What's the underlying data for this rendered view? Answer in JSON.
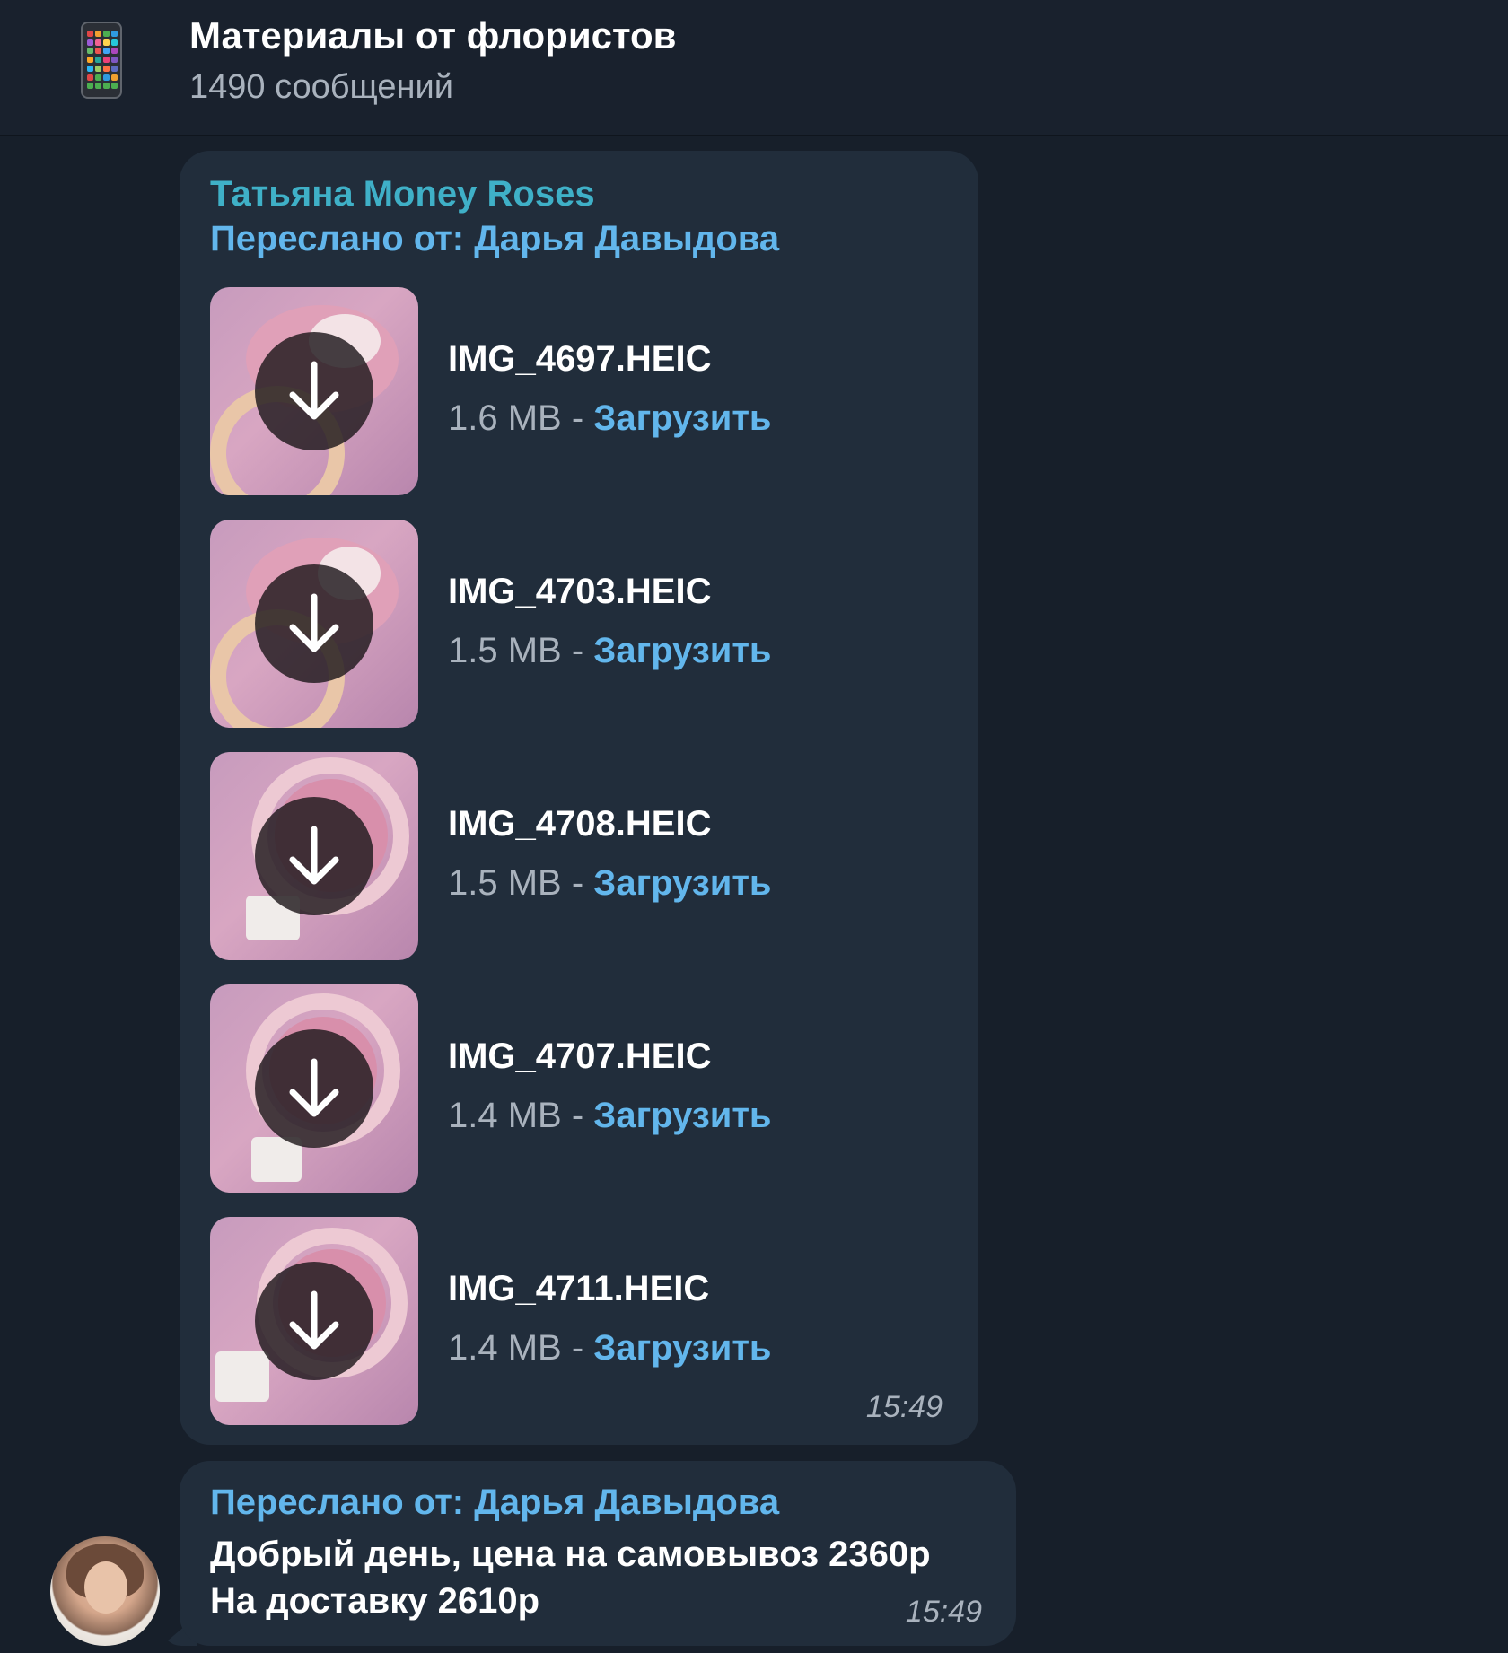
{
  "header": {
    "title": "Материалы от флористов",
    "subtitle": "1490 сообщений",
    "icon": "phone-app-grid-icon"
  },
  "messages": [
    {
      "sender": "Татьяна Money Roses",
      "forwarded_label": "Переслано от: Дарья Давыдова",
      "time": "15:49",
      "files": [
        {
          "name": "IMG_4697.HEIC",
          "size": "1.6 MB",
          "sep": " - ",
          "action": "Загрузить"
        },
        {
          "name": "IMG_4703.HEIC",
          "size": "1.5 MB",
          "sep": " - ",
          "action": "Загрузить"
        },
        {
          "name": "IMG_4708.HEIC",
          "size": "1.5 MB",
          "sep": " - ",
          "action": "Загрузить"
        },
        {
          "name": "IMG_4707.HEIC",
          "size": "1.4 MB",
          "sep": " - ",
          "action": "Загрузить"
        },
        {
          "name": "IMG_4711.HEIC",
          "size": "1.4 MB",
          "sep": " - ",
          "action": "Загрузить"
        }
      ]
    },
    {
      "forwarded_label": "Переслано от: Дарья Давыдова",
      "text_line1": "Добрый день, цена на самовывоз  2360р",
      "text_line2": "На доставку 2610р",
      "time": "15:49"
    }
  ],
  "colors": {
    "background": "#171f2a",
    "bubble": "#212d3b",
    "sender": "#3fb0c7",
    "link": "#62b6ec",
    "muted": "#a9b2bd"
  }
}
